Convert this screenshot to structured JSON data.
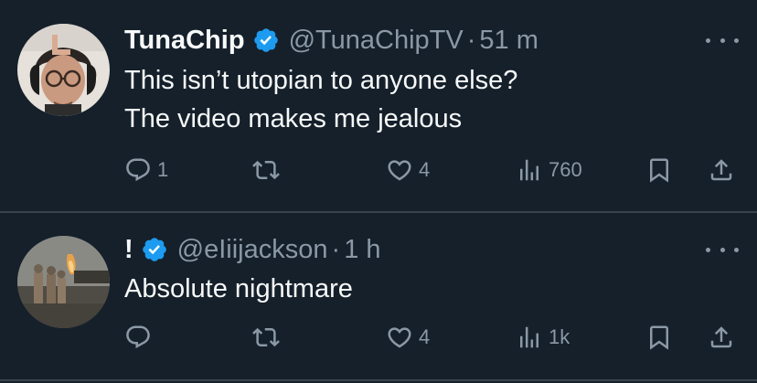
{
  "tweets": [
    {
      "display_name": "TunaChip",
      "verified": true,
      "handle": "@TunaChipTV",
      "separator": "·",
      "time": "51 m",
      "text_lines": [
        "This isn’t utopian to anyone else?",
        "The video makes me jealous"
      ],
      "replies": "1",
      "retweets": "",
      "likes": "4",
      "views": "760"
    },
    {
      "display_name": "!",
      "verified": true,
      "handle": "@eIiijackson",
      "separator": "·",
      "time": "1 h",
      "text_lines": [
        "Absolute nightmare"
      ],
      "replies": "",
      "retweets": "",
      "likes": "4",
      "views": "1k"
    }
  ],
  "colors": {
    "background": "#15202b",
    "text": "#f7f9f9",
    "muted": "#8b98a5",
    "verified": "#1d9bf0",
    "divider": "#38444d"
  },
  "icons": [
    "verified-badge-icon",
    "more-icon",
    "reply-icon",
    "retweet-icon",
    "like-icon",
    "views-icon",
    "bookmark-icon",
    "share-icon"
  ]
}
